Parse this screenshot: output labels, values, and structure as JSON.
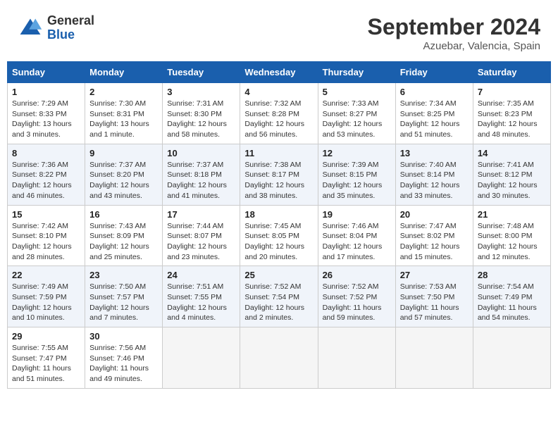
{
  "header": {
    "logo": {
      "general": "General",
      "blue": "Blue"
    },
    "title": "September 2024",
    "subtitle": "Azuebar, Valencia, Spain"
  },
  "calendar": {
    "weekdays": [
      "Sunday",
      "Monday",
      "Tuesday",
      "Wednesday",
      "Thursday",
      "Friday",
      "Saturday"
    ],
    "weeks": [
      [
        {
          "day": "1",
          "sunrise": "7:29 AM",
          "sunset": "8:33 PM",
          "daylight": "13 hours and 3 minutes."
        },
        {
          "day": "2",
          "sunrise": "7:30 AM",
          "sunset": "8:31 PM",
          "daylight": "13 hours and 1 minute."
        },
        {
          "day": "3",
          "sunrise": "7:31 AM",
          "sunset": "8:30 PM",
          "daylight": "12 hours and 58 minutes."
        },
        {
          "day": "4",
          "sunrise": "7:32 AM",
          "sunset": "8:28 PM",
          "daylight": "12 hours and 56 minutes."
        },
        {
          "day": "5",
          "sunrise": "7:33 AM",
          "sunset": "8:27 PM",
          "daylight": "12 hours and 53 minutes."
        },
        {
          "day": "6",
          "sunrise": "7:34 AM",
          "sunset": "8:25 PM",
          "daylight": "12 hours and 51 minutes."
        },
        {
          "day": "7",
          "sunrise": "7:35 AM",
          "sunset": "8:23 PM",
          "daylight": "12 hours and 48 minutes."
        }
      ],
      [
        {
          "day": "8",
          "sunrise": "7:36 AM",
          "sunset": "8:22 PM",
          "daylight": "12 hours and 46 minutes."
        },
        {
          "day": "9",
          "sunrise": "7:37 AM",
          "sunset": "8:20 PM",
          "daylight": "12 hours and 43 minutes."
        },
        {
          "day": "10",
          "sunrise": "7:37 AM",
          "sunset": "8:18 PM",
          "daylight": "12 hours and 41 minutes."
        },
        {
          "day": "11",
          "sunrise": "7:38 AM",
          "sunset": "8:17 PM",
          "daylight": "12 hours and 38 minutes."
        },
        {
          "day": "12",
          "sunrise": "7:39 AM",
          "sunset": "8:15 PM",
          "daylight": "12 hours and 35 minutes."
        },
        {
          "day": "13",
          "sunrise": "7:40 AM",
          "sunset": "8:14 PM",
          "daylight": "12 hours and 33 minutes."
        },
        {
          "day": "14",
          "sunrise": "7:41 AM",
          "sunset": "8:12 PM",
          "daylight": "12 hours and 30 minutes."
        }
      ],
      [
        {
          "day": "15",
          "sunrise": "7:42 AM",
          "sunset": "8:10 PM",
          "daylight": "12 hours and 28 minutes."
        },
        {
          "day": "16",
          "sunrise": "7:43 AM",
          "sunset": "8:09 PM",
          "daylight": "12 hours and 25 minutes."
        },
        {
          "day": "17",
          "sunrise": "7:44 AM",
          "sunset": "8:07 PM",
          "daylight": "12 hours and 23 minutes."
        },
        {
          "day": "18",
          "sunrise": "7:45 AM",
          "sunset": "8:05 PM",
          "daylight": "12 hours and 20 minutes."
        },
        {
          "day": "19",
          "sunrise": "7:46 AM",
          "sunset": "8:04 PM",
          "daylight": "12 hours and 17 minutes."
        },
        {
          "day": "20",
          "sunrise": "7:47 AM",
          "sunset": "8:02 PM",
          "daylight": "12 hours and 15 minutes."
        },
        {
          "day": "21",
          "sunrise": "7:48 AM",
          "sunset": "8:00 PM",
          "daylight": "12 hours and 12 minutes."
        }
      ],
      [
        {
          "day": "22",
          "sunrise": "7:49 AM",
          "sunset": "7:59 PM",
          "daylight": "12 hours and 10 minutes."
        },
        {
          "day": "23",
          "sunrise": "7:50 AM",
          "sunset": "7:57 PM",
          "daylight": "12 hours and 7 minutes."
        },
        {
          "day": "24",
          "sunrise": "7:51 AM",
          "sunset": "7:55 PM",
          "daylight": "12 hours and 4 minutes."
        },
        {
          "day": "25",
          "sunrise": "7:52 AM",
          "sunset": "7:54 PM",
          "daylight": "12 hours and 2 minutes."
        },
        {
          "day": "26",
          "sunrise": "7:52 AM",
          "sunset": "7:52 PM",
          "daylight": "11 hours and 59 minutes."
        },
        {
          "day": "27",
          "sunrise": "7:53 AM",
          "sunset": "7:50 PM",
          "daylight": "11 hours and 57 minutes."
        },
        {
          "day": "28",
          "sunrise": "7:54 AM",
          "sunset": "7:49 PM",
          "daylight": "11 hours and 54 minutes."
        }
      ],
      [
        {
          "day": "29",
          "sunrise": "7:55 AM",
          "sunset": "7:47 PM",
          "daylight": "11 hours and 51 minutes."
        },
        {
          "day": "30",
          "sunrise": "7:56 AM",
          "sunset": "7:46 PM",
          "daylight": "11 hours and 49 minutes."
        },
        null,
        null,
        null,
        null,
        null
      ]
    ]
  }
}
